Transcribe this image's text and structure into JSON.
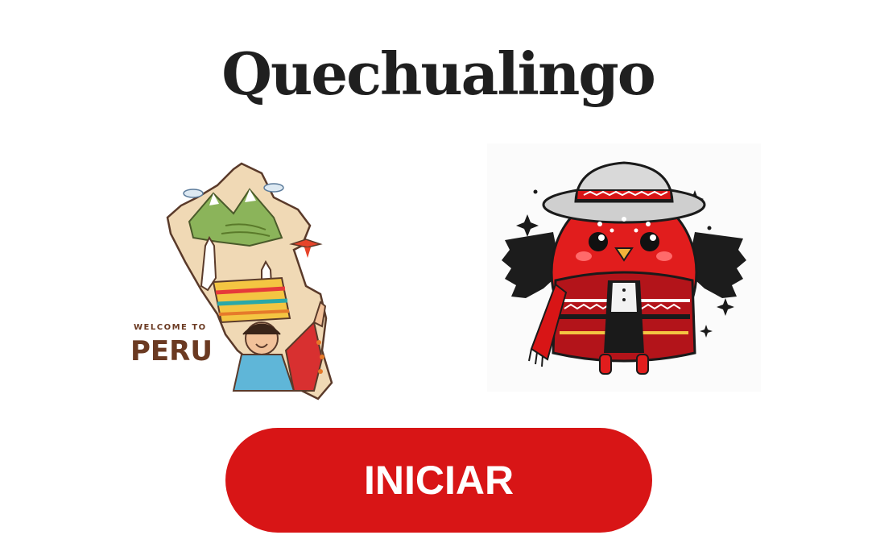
{
  "app": {
    "title": "Quechualingo"
  },
  "illustrations": {
    "peru_map": {
      "icon": "peru-map-illustration-icon",
      "caption_small": "WELCOME TO",
      "caption_big": "PERU"
    },
    "mascot": {
      "icon": "andean-bird-mascot-icon"
    }
  },
  "actions": {
    "start_label": "INICIAR"
  },
  "colors": {
    "accent": "#d81516",
    "title": "#1f1f1f",
    "caption": "#6b3a22"
  }
}
